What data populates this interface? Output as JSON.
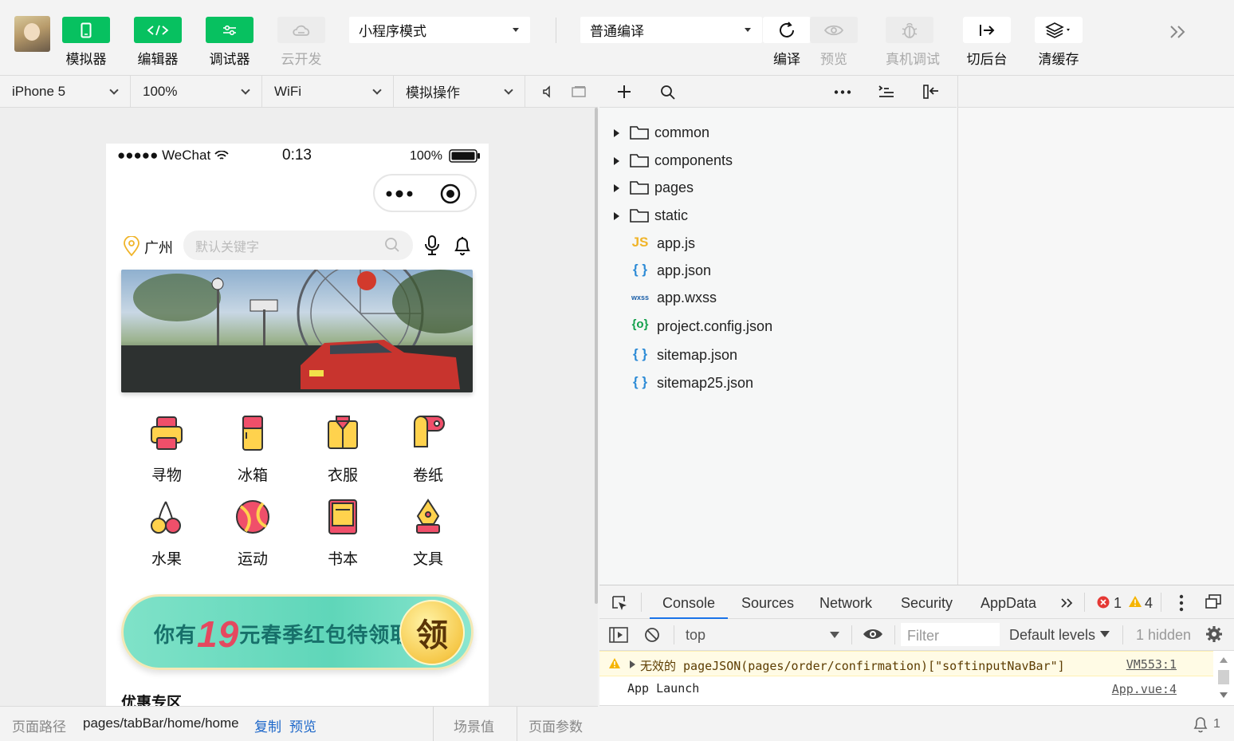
{
  "toolbar": {
    "simulator": "模拟器",
    "editor": "编辑器",
    "debugger": "调试器",
    "cloud": "云开发",
    "mode_select": "小程序模式",
    "compile_select": "普通编译",
    "compile": "编译",
    "preview": "预览",
    "remote_debug": "真机调试",
    "background": "切后台",
    "clear_cache": "清缓存"
  },
  "sim_header": {
    "device": "iPhone 5",
    "zoom": "100%",
    "network": "WiFi",
    "operation": "模拟操作"
  },
  "phone": {
    "carrier": "●●●●● WeChat",
    "time": "0:13",
    "battery": "100%",
    "location": "广州",
    "search_placeholder": "默认关键字",
    "categories": [
      {
        "label": "寻物",
        "icon": "printer-icon"
      },
      {
        "label": "冰箱",
        "icon": "fridge-icon"
      },
      {
        "label": "衣服",
        "icon": "shirt-icon"
      },
      {
        "label": "卷纸",
        "icon": "tissue-roll-icon"
      },
      {
        "label": "水果",
        "icon": "cherry-icon"
      },
      {
        "label": "运动",
        "icon": "ball-icon"
      },
      {
        "label": "书本",
        "icon": "book-icon"
      },
      {
        "label": "文具",
        "icon": "pen-icon"
      }
    ],
    "coupon_prefix": "你有",
    "coupon_amount": "19",
    "coupon_suffix": "元春季红包待领取",
    "coupon_button": "领",
    "section_title": "优惠专区"
  },
  "path_bar": {
    "label": "页面路径",
    "path": "pages/tabBar/home/home",
    "copy": "复制",
    "preview": "预览",
    "scene": "场景值",
    "params": "页面参数"
  },
  "file_tree": {
    "folders": [
      "common",
      "components",
      "pages",
      "static"
    ],
    "files": [
      {
        "name": "app.js",
        "type": "JS"
      },
      {
        "name": "app.json",
        "type": "{ }"
      },
      {
        "name": "app.wxss",
        "type": "wxss"
      },
      {
        "name": "project.config.json",
        "type": "{o}"
      },
      {
        "name": "sitemap.json",
        "type": "{ }"
      },
      {
        "name": "sitemap25.json",
        "type": "{ }"
      }
    ]
  },
  "devtools": {
    "tabs": [
      "Console",
      "Sources",
      "Network",
      "Security",
      "AppData"
    ],
    "active_tab": "Console",
    "error_count": "1",
    "warning_count": "4",
    "context": "top",
    "filter_placeholder": "Filter",
    "levels": "Default levels",
    "hidden": "1 hidden",
    "warn_message": "无效的 pageJSON(pages/order/confirmation)[\"softinputNavBar\"]",
    "warn_source": "VM553:1",
    "log_message": "App Launch",
    "log_source": "App.vue:4",
    "notification_count": "1"
  },
  "colors": {
    "accent_green": "#07c160",
    "warning_bg": "#fffbe5",
    "error_red": "#e53935",
    "warning_yellow": "#f5b400"
  }
}
